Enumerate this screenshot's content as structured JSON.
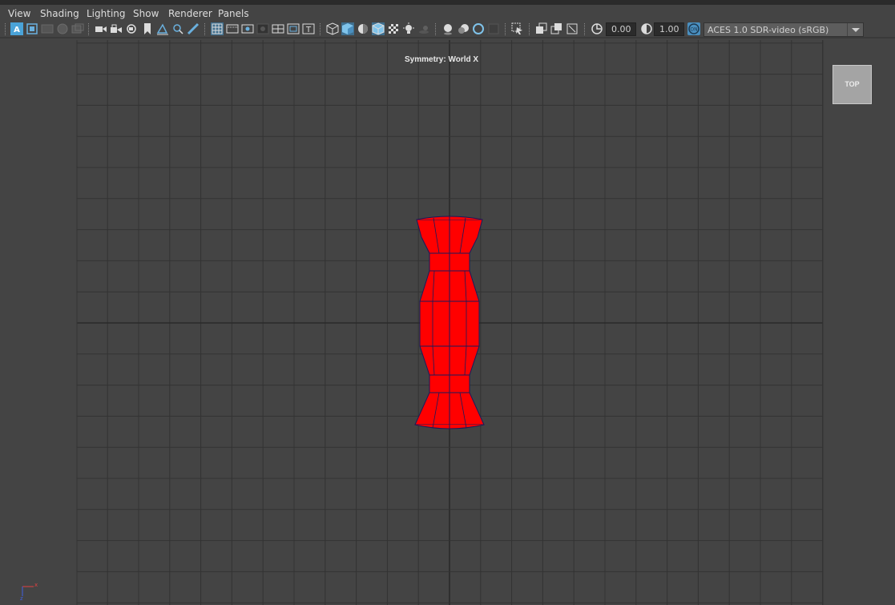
{
  "menu": {
    "items": [
      {
        "label": "View"
      },
      {
        "label": "Shading"
      },
      {
        "label": "Lighting"
      },
      {
        "label": "Show"
      },
      {
        "label": "Renderer"
      },
      {
        "label": "Panels"
      }
    ]
  },
  "toolbar": {
    "select_camera_label": "A",
    "exposure_value": "0.00",
    "gamma_value": "1.00",
    "color_management_label": "ON",
    "color_space": "ACES 1.0 SDR-video (sRGB)",
    "icons": [
      "select-camera-icon",
      "camera-attributes-icon",
      "bookmarks-icon",
      "image-plane-icon",
      "2d-pan-zoom-icon",
      "camera-icon",
      "lock-camera-icon",
      "camera-sync-icon",
      "bookmark-icon",
      "grease-pencil-icon",
      "grid-toggle-icon",
      "film-gate-icon",
      "resolution-gate-icon",
      "gate-mask-icon",
      "field-chart-icon",
      "safe-action-icon",
      "safe-title-icon",
      "wireframe-icon",
      "smooth-shade-icon",
      "default-material-icon",
      "wireframe-on-shaded-icon",
      "textured-icon",
      "use-all-lights-icon",
      "shadows-icon",
      "screen-space-ao-icon",
      "motion-blur-icon",
      "anti-aliasing-icon",
      "depth-of-field-icon",
      "isolate-select-icon",
      "xray-icon",
      "xray-joints-icon",
      "backface-culling-icon",
      "exposure-icon",
      "gamma-icon",
      "color-management-icon"
    ]
  },
  "viewport": {
    "symmetry_label": "Symmetry: World X",
    "viewcube_label": "TOP",
    "camera": "top",
    "object": {
      "type": "polygon-vase",
      "color": "#ff0000",
      "wire_color": "#1a1a5a"
    },
    "grid_color": "#333333",
    "axis_color": "#2a2a2a",
    "background": "#444444",
    "axis_gizmo": {
      "x": "x",
      "z": "z"
    }
  }
}
